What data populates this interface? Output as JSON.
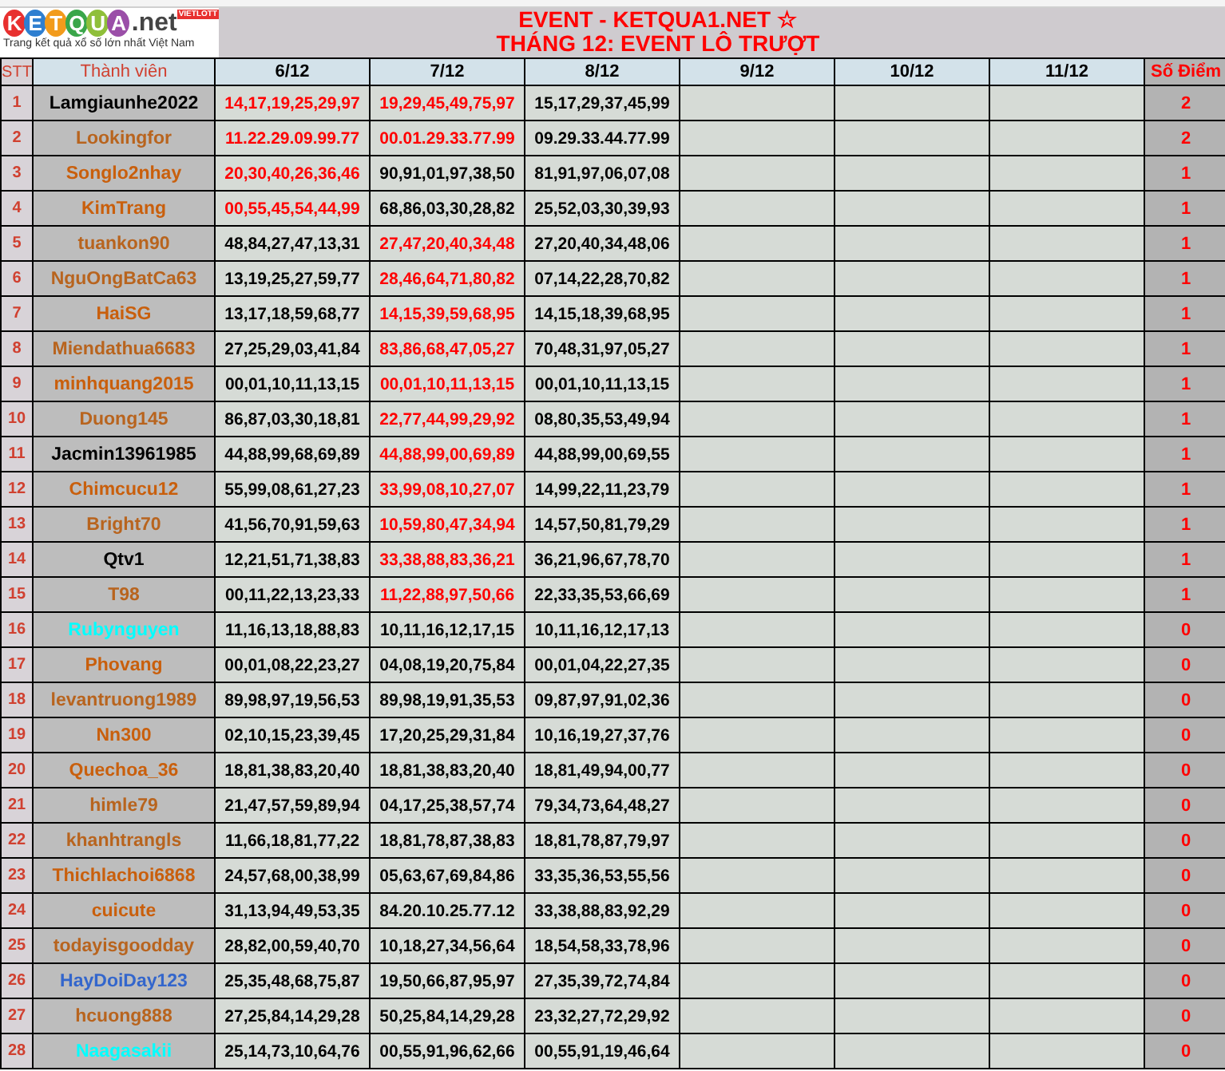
{
  "logo": {
    "letters": [
      {
        "text": "K",
        "color": "#e8302f"
      },
      {
        "text": "E",
        "color": "#2f7fd0"
      },
      {
        "text": "T",
        "color": "#f29b1c"
      },
      {
        "text": "Q",
        "color": "#3aa64a"
      },
      {
        "text": "U",
        "color": "#8fbf3a"
      },
      {
        "text": "A",
        "color": "#9b4fa8"
      }
    ],
    "suffix": ".net",
    "badge": "VIETLOTT",
    "tagline": "Trang kết quả xổ số lớn nhất Việt Nam"
  },
  "title": [
    "EVENT - KETQUA1.NET ☆",
    "THÁNG 12: EVENT LÔ TRƯỢT"
  ],
  "columns": [
    "STT",
    "Thành viên",
    "6/12",
    "7/12",
    "8/12",
    "9/12",
    "10/12",
    "11/12",
    "Số Điểm"
  ],
  "rows": [
    {
      "no": "1",
      "name": "Lamgiaunhe2022",
      "color": "#000000",
      "days": [
        {
          "text": "14,17,19,25,29,97",
          "marked": true
        },
        {
          "text": "19,29,45,49,75,97",
          "marked": true
        },
        {
          "text": "15,17,29,37,45,99",
          "marked": false
        }
      ],
      "score": "2"
    },
    {
      "no": "2",
      "name": "Lookingfor",
      "color": "#b8641e",
      "days": [
        {
          "text": "11.22.29.09.99.77",
          "marked": true
        },
        {
          "text": "00.01.29.33.77.99",
          "marked": true
        },
        {
          "text": "09.29.33.44.77.99",
          "marked": false
        }
      ],
      "score": "2"
    },
    {
      "no": "3",
      "name": "Songlo2nhay",
      "color": "#c95f0c",
      "days": [
        {
          "text": "20,30,40,26,36,46",
          "marked": true
        },
        {
          "text": "90,91,01,97,38,50",
          "marked": false
        },
        {
          "text": "81,91,97,06,07,08",
          "marked": false
        }
      ],
      "score": "1"
    },
    {
      "no": "4",
      "name": "KimTrang",
      "color": "#c95f0c",
      "days": [
        {
          "text": "00,55,45,54,44,99",
          "marked": true
        },
        {
          "text": "68,86,03,30,28,82",
          "marked": false
        },
        {
          "text": "25,52,03,30,39,93",
          "marked": false
        }
      ],
      "score": "1"
    },
    {
      "no": "5",
      "name": "tuankon90",
      "color": "#b8641e",
      "days": [
        {
          "text": "48,84,27,47,13,31",
          "marked": false
        },
        {
          "text": "27,47,20,40,34,48",
          "marked": true
        },
        {
          "text": "27,20,40,34,48,06",
          "marked": false
        }
      ],
      "score": "1"
    },
    {
      "no": "6",
      "name": "NguOngBatCa63",
      "color": "#b8641e",
      "days": [
        {
          "text": "13,19,25,27,59,77",
          "marked": false
        },
        {
          "text": "28,46,64,71,80,82",
          "marked": true
        },
        {
          "text": "07,14,22,28,70,82",
          "marked": false
        }
      ],
      "score": "1"
    },
    {
      "no": "7",
      "name": "HaiSG",
      "color": "#c95f0c",
      "days": [
        {
          "text": "13,17,18,59,68,77",
          "marked": false
        },
        {
          "text": "14,15,39,59,68,95",
          "marked": true
        },
        {
          "text": "14,15,18,39,68,95",
          "marked": false
        }
      ],
      "score": "1"
    },
    {
      "no": "8",
      "name": "Miendathua6683",
      "color": "#b8641e",
      "days": [
        {
          "text": "27,25,29,03,41,84",
          "marked": false
        },
        {
          "text": "83,86,68,47,05,27",
          "marked": true
        },
        {
          "text": "70,48,31,97,05,27",
          "marked": false
        }
      ],
      "score": "1"
    },
    {
      "no": "9",
      "name": "minhquang2015",
      "color": "#c95f0c",
      "days": [
        {
          "text": "00,01,10,11,13,15",
          "marked": false
        },
        {
          "text": "00,01,10,11,13,15",
          "marked": true
        },
        {
          "text": "00,01,10,11,13,15",
          "marked": false
        }
      ],
      "score": "1"
    },
    {
      "no": "10",
      "name": "Duong145",
      "color": "#b8641e",
      "days": [
        {
          "text": "86,87,03,30,18,81",
          "marked": false
        },
        {
          "text": "22,77,44,99,29,92",
          "marked": true
        },
        {
          "text": "08,80,35,53,49,94",
          "marked": false
        }
      ],
      "score": "1"
    },
    {
      "no": "11",
      "name": "Jacmin13961985",
      "color": "#000000",
      "days": [
        {
          "text": "44,88,99,68,69,89",
          "marked": false
        },
        {
          "text": "44,88,99,00,69,89",
          "marked": true
        },
        {
          "text": "44,88,99,00,69,55",
          "marked": false
        }
      ],
      "score": "1"
    },
    {
      "no": "12",
      "name": "Chimcucu12",
      "color": "#c95f0c",
      "days": [
        {
          "text": "55,99,08,61,27,23",
          "marked": false
        },
        {
          "text": "33,99,08,10,27,07",
          "marked": true
        },
        {
          "text": "14,99,22,11,23,79",
          "marked": false
        }
      ],
      "score": "1"
    },
    {
      "no": "13",
      "name": "Bright70",
      "color": "#b8641e",
      "days": [
        {
          "text": "41,56,70,91,59,63",
          "marked": false
        },
        {
          "text": "10,59,80,47,34,94",
          "marked": true
        },
        {
          "text": "14,57,50,81,79,29",
          "marked": false
        }
      ],
      "score": "1"
    },
    {
      "no": "14",
      "name": "Qtv1",
      "color": "#000000",
      "days": [
        {
          "text": "12,21,51,71,38,83",
          "marked": false
        },
        {
          "text": "33,38,88,83,36,21",
          "marked": true
        },
        {
          "text": "36,21,96,67,78,70",
          "marked": false
        }
      ],
      "score": "1"
    },
    {
      "no": "15",
      "name": "T98",
      "color": "#b8641e",
      "days": [
        {
          "text": "00,11,22,13,23,33",
          "marked": false
        },
        {
          "text": "11,22,88,97,50,66",
          "marked": true
        },
        {
          "text": "22,33,35,53,66,69",
          "marked": false
        }
      ],
      "score": "1"
    },
    {
      "no": "16",
      "name": "Rubynguyen",
      "color": "#00ffff",
      "days": [
        {
          "text": "11,16,13,18,88,83",
          "marked": false
        },
        {
          "text": "10,11,16,12,17,15",
          "marked": false
        },
        {
          "text": "10,11,16,12,17,13",
          "marked": false
        }
      ],
      "score": "0"
    },
    {
      "no": "17",
      "name": "Phovang",
      "color": "#c95f0c",
      "days": [
        {
          "text": "00,01,08,22,23,27",
          "marked": false
        },
        {
          "text": "04,08,19,20,75,84",
          "marked": false
        },
        {
          "text": "00,01,04,22,27,35",
          "marked": false
        }
      ],
      "score": "0"
    },
    {
      "no": "18",
      "name": "levantruong1989",
      "color": "#b8641e",
      "days": [
        {
          "text": "89,98,97,19,56,53",
          "marked": false
        },
        {
          "text": "89,98,19,91,35,53",
          "marked": false
        },
        {
          "text": "09,87,97,91,02,36",
          "marked": false
        }
      ],
      "score": "0"
    },
    {
      "no": "19",
      "name": "Nn300",
      "color": "#c95f0c",
      "days": [
        {
          "text": "02,10,15,23,39,45",
          "marked": false
        },
        {
          "text": "17,20,25,29,31,84",
          "marked": false
        },
        {
          "text": "10,16,19,27,37,76",
          "marked": false
        }
      ],
      "score": "0"
    },
    {
      "no": "20",
      "name": "Quechoa_36",
      "color": "#c95f0c",
      "days": [
        {
          "text": "18,81,38,83,20,40",
          "marked": false
        },
        {
          "text": "18,81,38,83,20,40",
          "marked": false
        },
        {
          "text": "18,81,49,94,00,77",
          "marked": false
        }
      ],
      "score": "0"
    },
    {
      "no": "21",
      "name": "himle79",
      "color": "#b8641e",
      "days": [
        {
          "text": "21,47,57,59,89,94",
          "marked": false
        },
        {
          "text": "04,17,25,38,57,74",
          "marked": false
        },
        {
          "text": "79,34,73,64,48,27",
          "marked": false
        }
      ],
      "score": "0"
    },
    {
      "no": "22",
      "name": "khanhtrangls",
      "color": "#b8641e",
      "days": [
        {
          "text": "11,66,18,81,77,22",
          "marked": false
        },
        {
          "text": "18,81,78,87,38,83",
          "marked": false
        },
        {
          "text": "18,81,78,87,79,97",
          "marked": false
        }
      ],
      "score": "0"
    },
    {
      "no": "23",
      "name": "Thichlachoi6868",
      "color": "#c95f0c",
      "days": [
        {
          "text": "24,57,68,00,38,99",
          "marked": false
        },
        {
          "text": "05,63,67,69,84,86",
          "marked": false
        },
        {
          "text": "33,35,36,53,55,56",
          "marked": false
        }
      ],
      "score": "0"
    },
    {
      "no": "24",
      "name": "cuicute",
      "color": "#c95f0c",
      "days": [
        {
          "text": "31,13,94,49,53,35",
          "marked": false
        },
        {
          "text": "84.20.10.25.77.12",
          "marked": false
        },
        {
          "text": "33,38,88,83,92,29",
          "marked": false
        }
      ],
      "score": "0"
    },
    {
      "no": "25",
      "name": "todayisgoodday",
      "color": "#b8641e",
      "days": [
        {
          "text": "28,82,00,59,40,70",
          "marked": false
        },
        {
          "text": "10,18,27,34,56,64",
          "marked": false
        },
        {
          "text": "18,54,58,33,78,96",
          "marked": false
        }
      ],
      "score": "0"
    },
    {
      "no": "26",
      "name": "HayDoiDay123",
      "color": "#3366cc",
      "days": [
        {
          "text": "25,35,48,68,75,87",
          "marked": false
        },
        {
          "text": "19,50,66,87,95,97",
          "marked": false
        },
        {
          "text": "27,35,39,72,74,84",
          "marked": false
        }
      ],
      "score": "0"
    },
    {
      "no": "27",
      "name": "hcuong888",
      "color": "#b8641e",
      "days": [
        {
          "text": "27,25,84,14,29,28",
          "marked": false
        },
        {
          "text": "50,25,84,14,29,28",
          "marked": false
        },
        {
          "text": "23,32,27,72,29,92",
          "marked": false
        }
      ],
      "score": "0"
    },
    {
      "no": "28",
      "name": "Naagasakii",
      "color": "#00ffff",
      "days": [
        {
          "text": "25,14,73,10,64,76",
          "marked": false
        },
        {
          "text": "00,55,91,96,62,66",
          "marked": false
        },
        {
          "text": "00,55,91,19,46,64",
          "marked": false
        }
      ],
      "score": "0"
    }
  ]
}
